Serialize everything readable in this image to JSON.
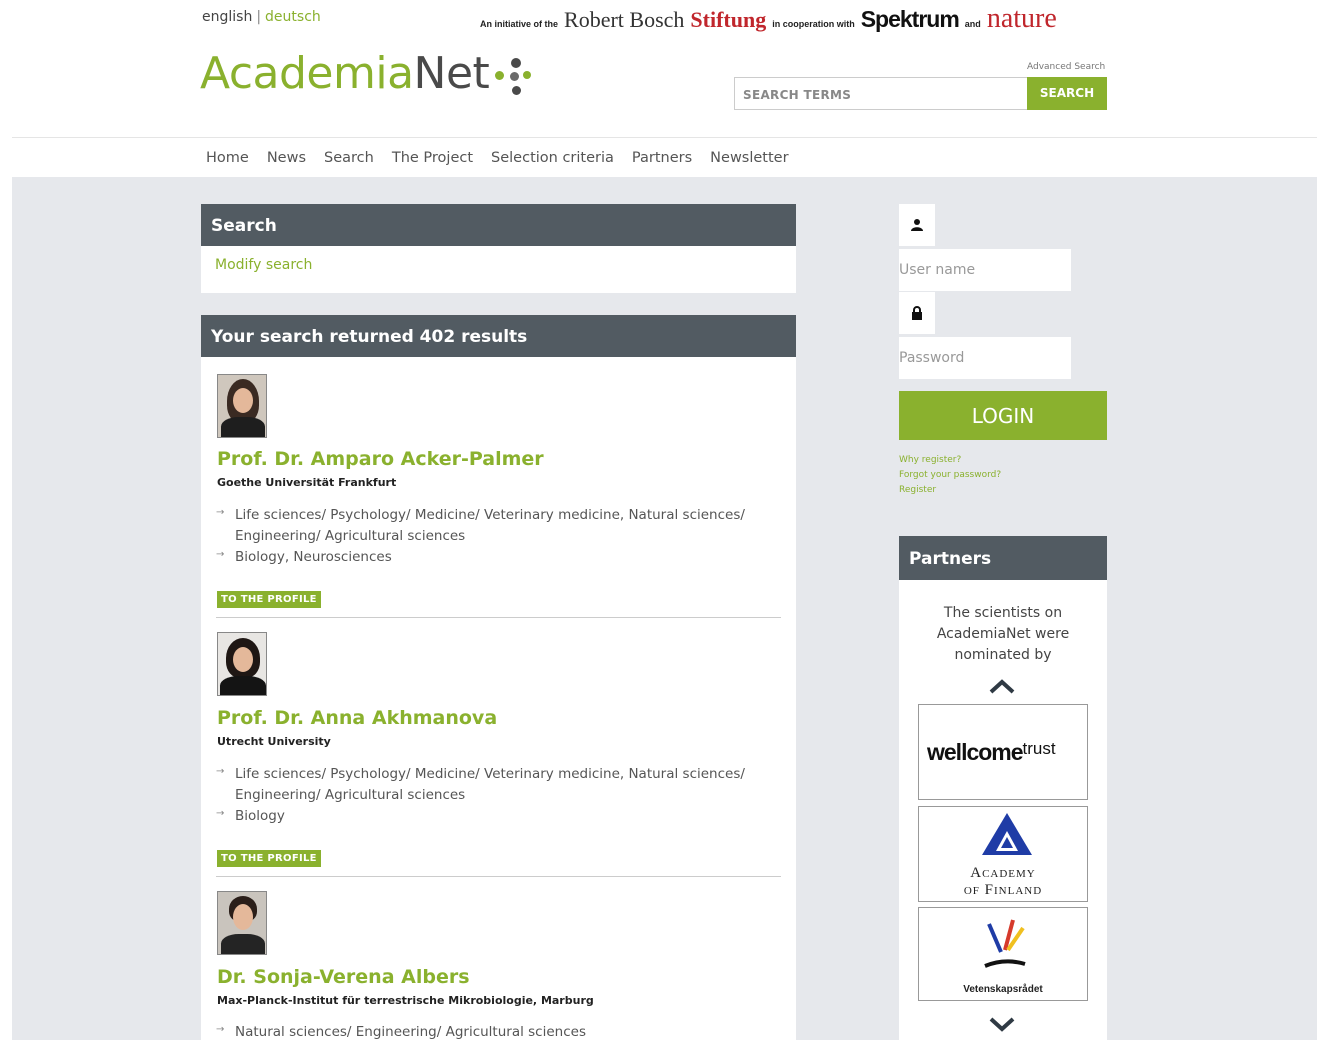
{
  "lang": {
    "en": "english",
    "sep": "|",
    "de": "deutsch"
  },
  "initiative": {
    "prefix": "An initiative of the",
    "robert_bosch": "Robert Bosch",
    "stiftung": "Stiftung",
    "cooperation": "in cooperation with",
    "spektrum": "Spektrum",
    "and": "and",
    "nature": "nature"
  },
  "logo": {
    "part1": "Academia",
    "part2": "Net"
  },
  "header": {
    "advanced_search": "Advanced Search",
    "search_placeholder": "SEARCH TERMS",
    "search_button": "SEARCH"
  },
  "nav": [
    "Home",
    "News",
    "Search",
    "The Project",
    "Selection criteria",
    "Partners",
    "Newsletter"
  ],
  "search_panel": {
    "title": "Search",
    "modify": "Modify search"
  },
  "results": {
    "title": "Your search returned 402 results",
    "profile_button": "TO THE PROFILE",
    "items": [
      {
        "name": "Prof. Dr. Amparo Acker-Palmer",
        "institution": "Goethe Universität Frankfurt",
        "fields": [
          "Life sciences/ Psychology/ Medicine/ Veterinary medicine, Natural sciences/ Engineering/ Agricultural sciences",
          "Biology, Neurosciences"
        ]
      },
      {
        "name": "Prof. Dr. Anna Akhmanova",
        "institution": "Utrecht University",
        "fields": [
          "Life sciences/ Psychology/ Medicine/ Veterinary medicine, Natural sciences/ Engineering/ Agricultural sciences",
          "Biology"
        ]
      },
      {
        "name": "Dr. Sonja-Verena Albers",
        "institution": "Max-Planck-Institut für terrestrische Mikrobiologie, Marburg",
        "fields": [
          "Natural sciences/ Engineering/ Agricultural sciences"
        ]
      }
    ]
  },
  "login": {
    "username_placeholder": "User name",
    "password_placeholder": "Password",
    "button": "LOGIN",
    "why_register": "Why register?",
    "forgot": "Forgot your password?",
    "register": "Register"
  },
  "partners": {
    "title": "Partners",
    "text": "The scientists on AcademiaNet were nominated by",
    "logos": {
      "wellcome_bold": "wellcome",
      "wellcome_trust": "trust",
      "academy_line1": "Academy",
      "academy_line2": "of Finland",
      "vr": "Vetenskapsrådet"
    }
  },
  "colors": {
    "accent": "#8ab12e",
    "panel": "#525b62",
    "background": "#e6e8ec"
  }
}
